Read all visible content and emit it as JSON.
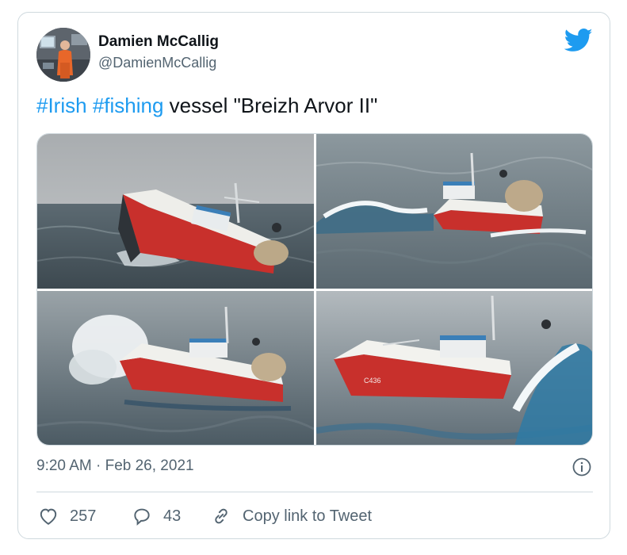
{
  "author": {
    "name": "Damien McCallig",
    "handle": "@DamienMcCallig"
  },
  "tweet": {
    "hashtag1": "#Irish",
    "hashtag2": "#fishing",
    "text": " vessel \"Breizh Arvor II\""
  },
  "media": {
    "photo_count": 4,
    "hull_number": "C436"
  },
  "meta": {
    "timestamp": "9:20 AM · Feb 26, 2021"
  },
  "actions": {
    "likes": "257",
    "replies": "43",
    "copy_link_label": "Copy link to Tweet"
  },
  "colors": {
    "brand_blue": "#1d9bf0",
    "text_primary": "#0f1419",
    "text_secondary": "#536471",
    "border": "#cfd9de",
    "hull_red": "#c8302c"
  },
  "icons": [
    "twitter-bird-icon",
    "info-icon",
    "heart-icon",
    "reply-icon",
    "link-icon"
  ]
}
